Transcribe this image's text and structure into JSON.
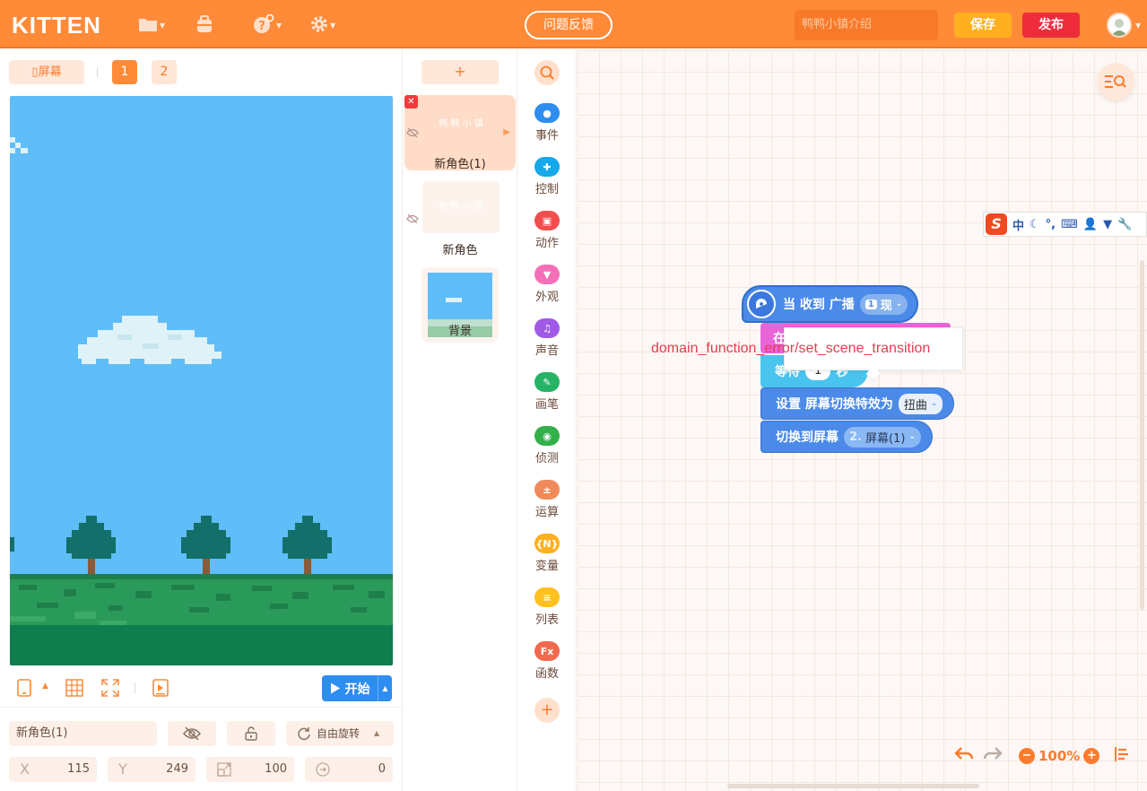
{
  "app": {
    "logo": "KITTEN",
    "feedback_label": "问题反馈",
    "project_title_placeholder": "鸭鸭小镇介绍",
    "save_label": "保存",
    "publish_label": "发布"
  },
  "stage": {
    "screen_label": "屏幕",
    "pages": [
      "1",
      "2"
    ],
    "start_label": "开始"
  },
  "properties": {
    "sprite_name": "新角色(1)",
    "rotation_label": "自由旋转",
    "x_label": "X",
    "x_value": "115",
    "y_label": "Y",
    "y_value": "249",
    "size_value": "100",
    "direction_value": "0"
  },
  "sprites": {
    "add_label": "+",
    "items": [
      {
        "name": "新角色(1)",
        "thumb_text": "鸭 鸭 小 镇"
      },
      {
        "name": "新角色",
        "thumb_text": "鸭 鸭 小 镇"
      },
      {
        "name": "背景",
        "thumb_text": ""
      }
    ]
  },
  "categories": [
    {
      "label": "事件",
      "color": "#2d8df0",
      "glyph": "●"
    },
    {
      "label": "控制",
      "color": "#16a8e8",
      "glyph": "✚"
    },
    {
      "label": "动作",
      "color": "#f24e4e",
      "glyph": "▣"
    },
    {
      "label": "外观",
      "color": "#f56fb8",
      "glyph": "▼"
    },
    {
      "label": "声音",
      "color": "#a05ae6",
      "glyph": "♫"
    },
    {
      "label": "画笔",
      "color": "#27b366",
      "glyph": "✎"
    },
    {
      "label": "侦测",
      "color": "#34b04a",
      "glyph": "◉"
    },
    {
      "label": "运算",
      "color": "#f08a5a",
      "glyph": "±"
    },
    {
      "label": "变量",
      "color": "#ffb020",
      "glyph": "{N}"
    },
    {
      "label": "列表",
      "color": "#ffc020",
      "glyph": "≡"
    },
    {
      "label": "函数",
      "color": "#f26a4e",
      "glyph": "Fx"
    }
  ],
  "ime": {
    "zh": "中"
  },
  "blocks": {
    "hat_label": "当 收到 广播",
    "hat_dd_num": "1",
    "hat_dd_value": "现",
    "pink_partial": "在",
    "wait_label": "等待",
    "wait_value": "1",
    "wait_unit": "秒",
    "transition_label": "设置 屏幕切换特效为",
    "transition_value": "扭曲",
    "switch_label": "切换到屏幕",
    "switch_dd_num": "2.",
    "switch_dd_value": "屏幕(1)"
  },
  "error_message": "domain_function_error/set_scene_transition",
  "workspace": {
    "zoom_value": "100%"
  }
}
